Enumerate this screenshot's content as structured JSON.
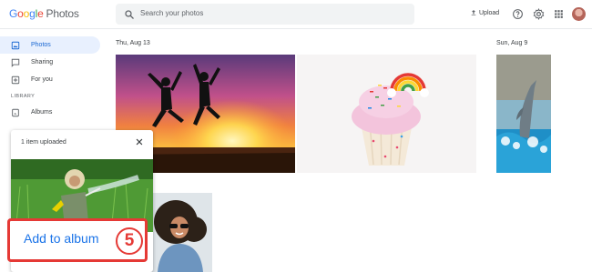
{
  "app": {
    "logo_google": [
      "G",
      "o",
      "o",
      "g",
      "l",
      "e"
    ],
    "logo_product": "Photos"
  },
  "search": {
    "placeholder": "Search your photos"
  },
  "topbar": {
    "upload_label": "Upload"
  },
  "sidebar": {
    "items": [
      {
        "label": "Photos",
        "icon": "photo-icon",
        "active": true
      },
      {
        "label": "Sharing",
        "icon": "chat-icon",
        "active": false
      },
      {
        "label": "For you",
        "icon": "plus-box-icon",
        "active": false
      }
    ],
    "section_label": "LIBRARY",
    "library_items": [
      {
        "label": "Albums",
        "icon": "album-icon"
      }
    ]
  },
  "main": {
    "groups": [
      {
        "date": "Thu, Aug 13"
      },
      {
        "date": "Sun, Aug 9"
      }
    ]
  },
  "toast": {
    "message": "1 item uploaded",
    "action_label": "Add to album"
  },
  "annotation": {
    "step_number": "5"
  },
  "colors": {
    "accent": "#1a73e8",
    "highlight": "#e53935",
    "active_bg": "#e8f0fe"
  }
}
